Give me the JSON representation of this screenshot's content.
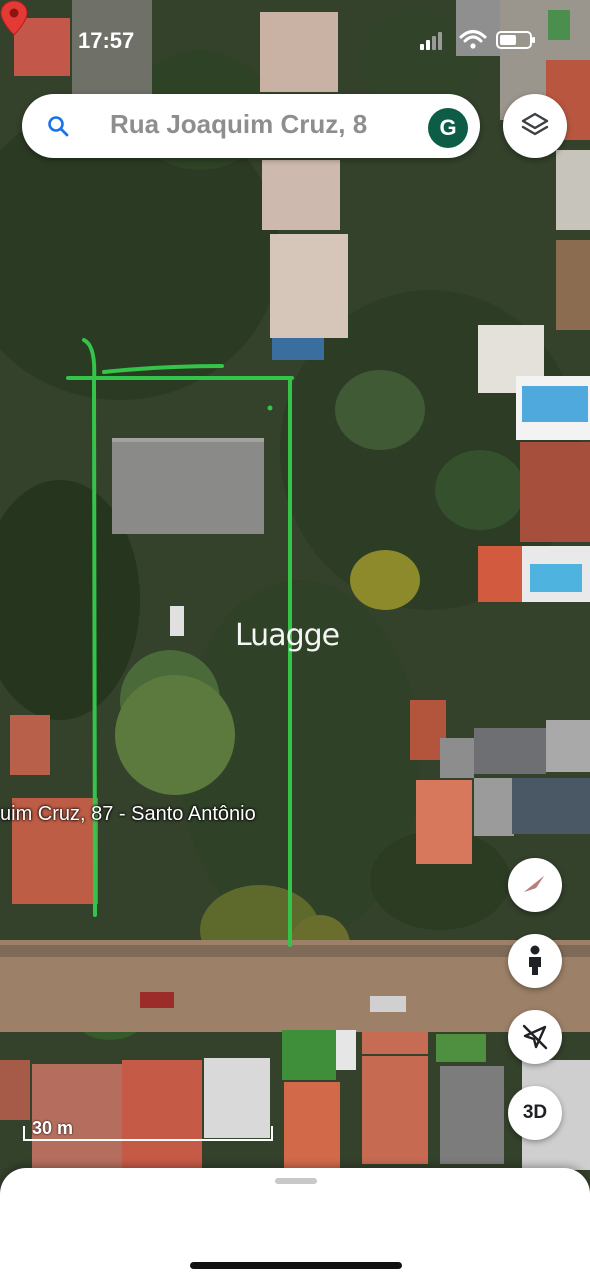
{
  "status_bar": {
    "time": "17:57"
  },
  "search": {
    "query": "Rua Joaquim Cruz, 8",
    "avatar_letter": "G"
  },
  "map": {
    "watermark": "Luagge",
    "place_label": "uim Cruz, 87 - Santo Antônio",
    "scale_label": "30 m"
  },
  "controls": {
    "three_d_label": "3D"
  },
  "colors": {
    "annotation": "#34c44a",
    "pin": "#e53935",
    "avatar": "#0d5c46"
  }
}
